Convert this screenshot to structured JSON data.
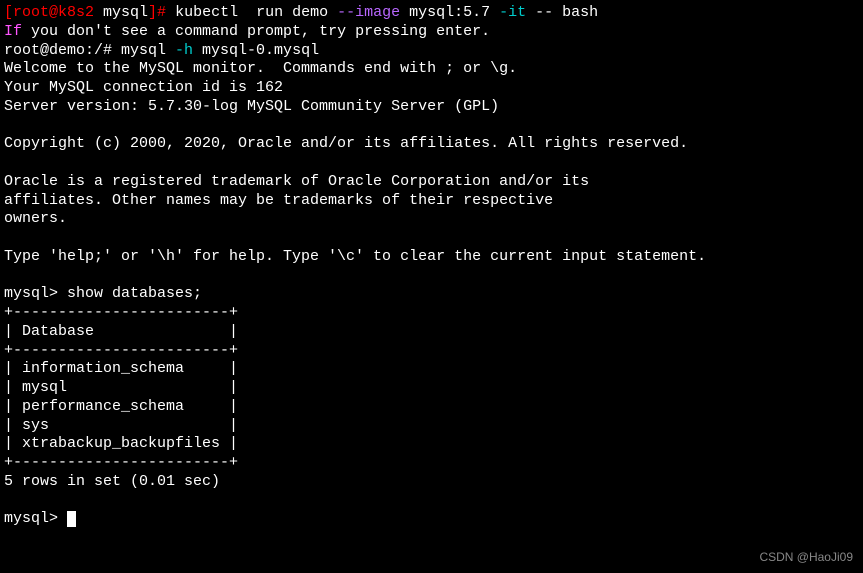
{
  "prompt1": {
    "bracket_open": "[",
    "user_host": "root@k8s2",
    "path": " mysql",
    "bracket_close": "]# ",
    "command_part1": "kubectl  run demo ",
    "flag1": "--image",
    "command_part2": " mysql:5.7 ",
    "flag2": "-it",
    "command_part3": " -- bash"
  },
  "line2": {
    "if_word": "If",
    "rest": " you don't see a command prompt, try pressing enter."
  },
  "prompt2": {
    "prefix": "root@demo:/# mysql ",
    "flag": "-h",
    "rest": " mysql-0.mysql"
  },
  "welcome_line1": "Welcome to the MySQL monitor.  Commands end with ; or \\g.",
  "welcome_line2": "Your MySQL connection id is 162",
  "welcome_line3": "Server version: 5.7.30-log MySQL Community Server (GPL)",
  "copyright": "Copyright (c) 2000, 2020, Oracle and/or its affiliates. All rights reserved.",
  "trademark1": "Oracle is a registered trademark of Oracle Corporation and/or its",
  "trademark2": "affiliates. Other names may be trademarks of their respective",
  "trademark3": "owners.",
  "help_line": "Type 'help;' or '\\h' for help. Type '\\c' to clear the current input statement.",
  "mysql_prompt1": "mysql> ",
  "query": "show databases;",
  "table_border": "+------------------------+",
  "table_header": "| Database               |",
  "table_rows": [
    "| information_schema     |",
    "| mysql                  |",
    "| performance_schema     |",
    "| sys                    |",
    "| xtrabackup_backupfiles |"
  ],
  "result_summary": "5 rows in set (0.01 sec)",
  "mysql_prompt2": "mysql> ",
  "watermark": "CSDN @HaoJi09"
}
